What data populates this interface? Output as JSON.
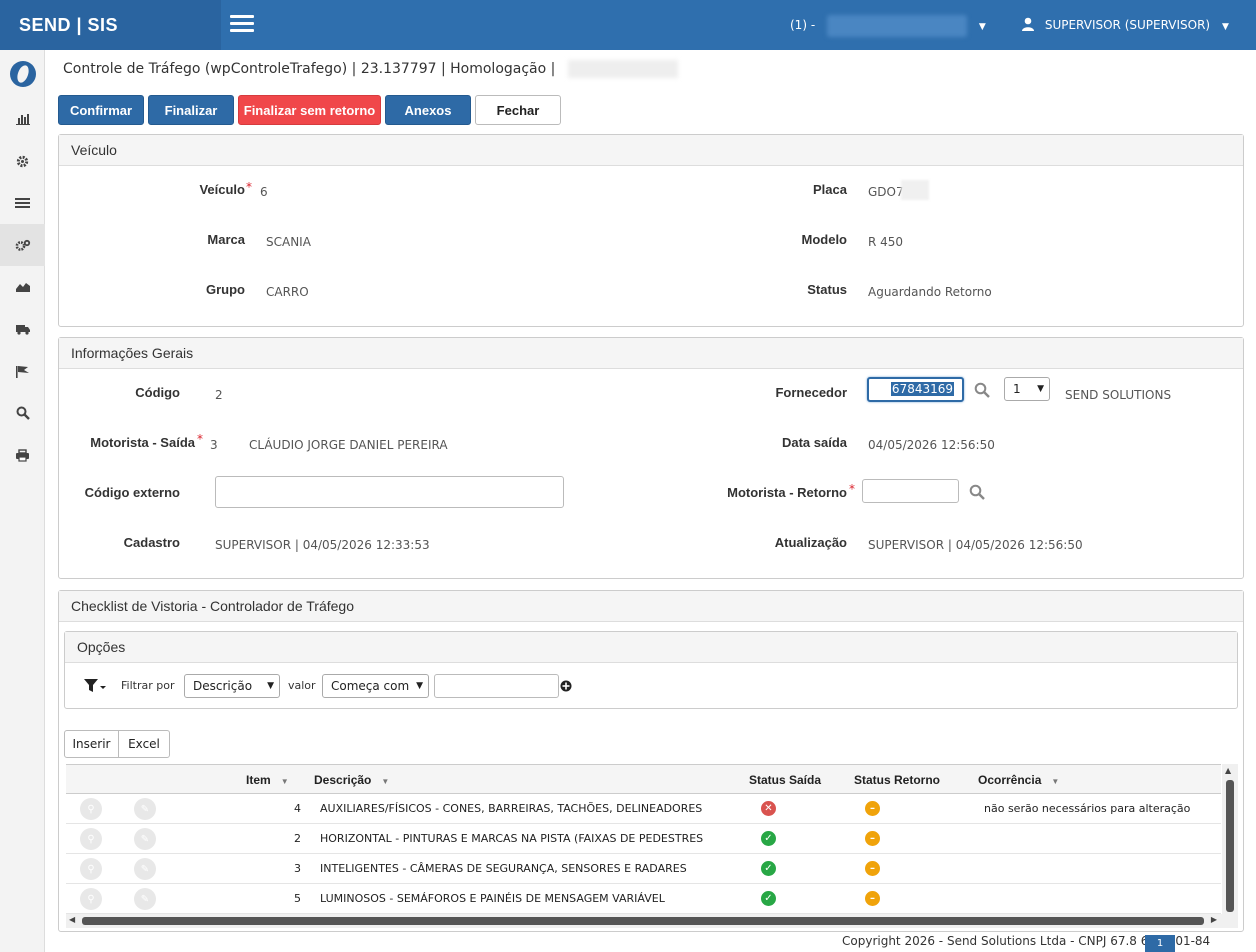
{
  "header": {
    "brand": "SEND | SIS",
    "company_prefix": "(1) -",
    "user_label": "SUPERVISOR (SUPERVISOR)"
  },
  "breadcrumb": "Controle de Tráfego (wpControleTrafego) | 23.137797 | Homologação |",
  "toolbar": {
    "confirm": "Confirmar",
    "finalize": "Finalizar",
    "finalize_no_return": "Finalizar sem retorno",
    "attachments": "Anexos",
    "close": "Fechar"
  },
  "vehicle": {
    "title": "Veículo",
    "veiculo_label": "Veículo",
    "veiculo_value": "6",
    "placa_label": "Placa",
    "placa_value": "GDO7",
    "marca_label": "Marca",
    "marca_value": "SCANIA",
    "modelo_label": "Modelo",
    "modelo_value": "R 450",
    "grupo_label": "Grupo",
    "grupo_value": "CARRO",
    "status_label": "Status",
    "status_value": "Aguardando Retorno"
  },
  "general": {
    "title": "Informações Gerais",
    "codigo_label": "Código",
    "codigo_value": "2",
    "fornecedor_label": "Fornecedor",
    "fornecedor_input": "67843169",
    "fornecedor_select": "1",
    "fornecedor_name": "SEND SOLUTIONS",
    "motorista_saida_label": "Motorista - Saída",
    "motorista_saida_code": "3",
    "motorista_saida_name": "CLÁUDIO JORGE DANIEL PEREIRA",
    "data_saida_label": "Data saída",
    "data_saida_value": "04/05/2026 12:56:50",
    "codigo_externo_label": "Código externo",
    "motorista_retorno_label": "Motorista - Retorno",
    "cadastro_label": "Cadastro",
    "cadastro_value": "SUPERVISOR | 04/05/2026 12:33:53",
    "atualizacao_label": "Atualização",
    "atualizacao_value": "SUPERVISOR | 04/05/2026 12:56:50"
  },
  "checklist": {
    "title": "Checklist de Vistoria - Controlador de Tráfego",
    "options_title": "Opções",
    "filter_by_label": "Filtrar por",
    "filter_field": "Descrição",
    "value_label": "valor",
    "filter_operator": "Começa com",
    "insert": "Inserir",
    "excel": "Excel",
    "columns": {
      "item": "Item",
      "descricao": "Descrição",
      "status_saida": "Status Saída",
      "status_retorno": "Status Retorno",
      "ocorrencia": "Ocorrência"
    },
    "rows": [
      {
        "item": "4",
        "descricao": "AUXILIARES/FÍSICOS - CONES, BARREIRAS, TACHÕES, DELINEADORES",
        "status_saida": "error",
        "status_retorno": "pending",
        "ocorrencia": "não serão necessários para alteração"
      },
      {
        "item": "2",
        "descricao": "HORIZONTAL - PINTURAS E MARCAS NA PISTA (FAIXAS DE PEDESTRES",
        "status_saida": "ok",
        "status_retorno": "pending",
        "ocorrencia": ""
      },
      {
        "item": "3",
        "descricao": "INTELIGENTES - CÂMERAS DE SEGURANÇA, SENSORES E RADARES",
        "status_saida": "ok",
        "status_retorno": "pending",
        "ocorrencia": ""
      },
      {
        "item": "5",
        "descricao": "LUMINOSOS - SEMÁFOROS E PAINÉIS DE MENSAGEM VARIÁVEL",
        "status_saida": "ok",
        "status_retorno": "pending",
        "ocorrencia": ""
      }
    ]
  },
  "footer": {
    "copyright": "Copyright 2026 - Send Solutions Ltda - CNPJ 67.8      69/0001-84",
    "page": "1"
  },
  "colors": {
    "primary": "#2f6fae",
    "danger": "#f0474a",
    "ok": "#28a745",
    "pending": "#f0a30a",
    "error": "#d9534f"
  }
}
